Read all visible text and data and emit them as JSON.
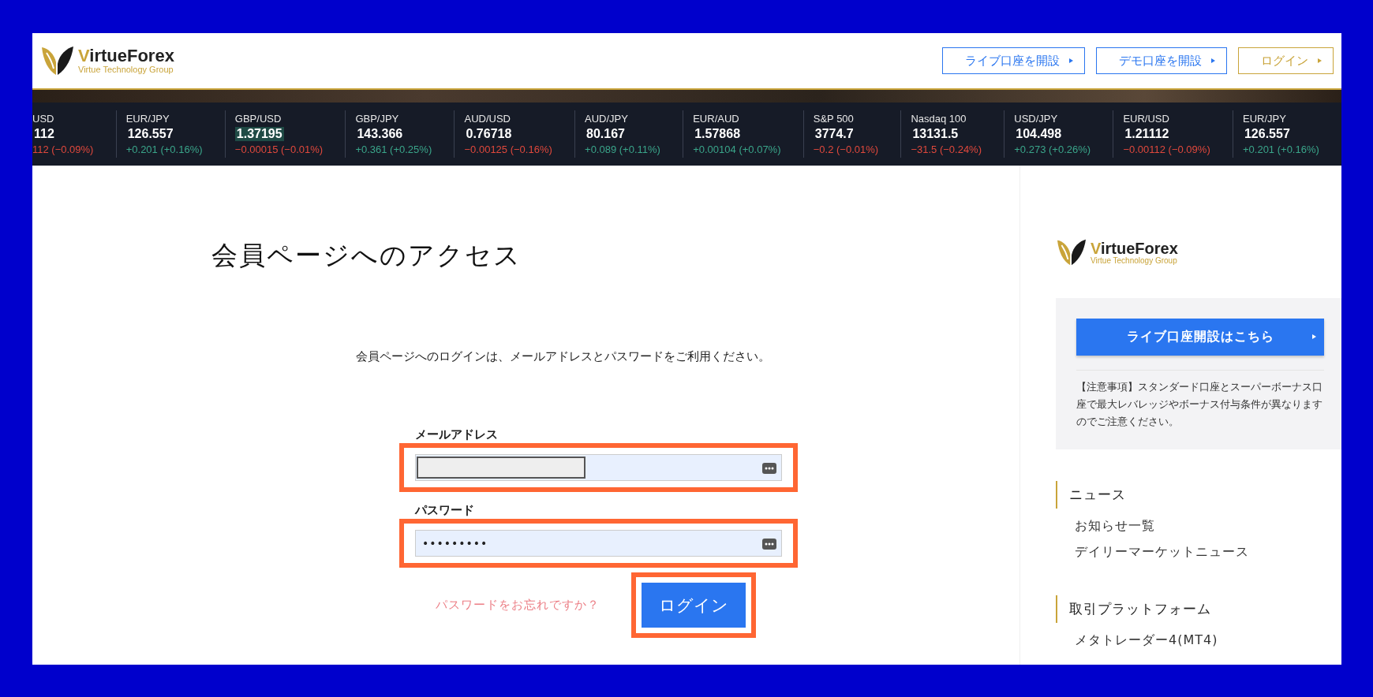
{
  "header": {
    "logo": {
      "name": "VirtueForex",
      "tagline": "Virtue Technology Group"
    },
    "buttons": [
      {
        "label": "ライブ口座を開設",
        "kind": "primary"
      },
      {
        "label": "デモ口座を開設",
        "kind": "primary"
      },
      {
        "label": "ログイン",
        "kind": "gold"
      }
    ]
  },
  "ticker": [
    {
      "symbol": "USD",
      "price": "112",
      "change": "112 (−0.09%)",
      "rising": false,
      "highlighted": false
    },
    {
      "symbol": "EUR/JPY",
      "price": "126.557",
      "change": "+0.201 (+0.16%)",
      "rising": true,
      "highlighted": false
    },
    {
      "symbol": "GBP/USD",
      "price": "1.37195",
      "change": "−0.00015 (−0.01%)",
      "rising": false,
      "highlighted": true
    },
    {
      "symbol": "GBP/JPY",
      "price": "143.366",
      "change": "+0.361 (+0.25%)",
      "rising": true,
      "highlighted": false
    },
    {
      "symbol": "AUD/USD",
      "price": "0.76718",
      "change": "−0.00125 (−0.16%)",
      "rising": false,
      "highlighted": false
    },
    {
      "symbol": "AUD/JPY",
      "price": "80.167",
      "change": "+0.089 (+0.11%)",
      "rising": true,
      "highlighted": false
    },
    {
      "symbol": "EUR/AUD",
      "price": "1.57868",
      "change": "+0.00104 (+0.07%)",
      "rising": true,
      "highlighted": false
    },
    {
      "symbol": "S&P 500",
      "price": "3774.7",
      "change": "−0.2 (−0.01%)",
      "rising": false,
      "highlighted": false
    },
    {
      "symbol": "Nasdaq 100",
      "price": "13131.5",
      "change": "−31.5 (−0.24%)",
      "rising": false,
      "highlighted": false
    },
    {
      "symbol": "USD/JPY",
      "price": "104.498",
      "change": "+0.273 (+0.26%)",
      "rising": true,
      "highlighted": false
    },
    {
      "symbol": "EUR/USD",
      "price": "1.21112",
      "change": "−0.00112 (−0.09%)",
      "rising": false,
      "highlighted": false
    },
    {
      "symbol": "EUR/JPY",
      "price": "126.557",
      "change": "+0.201 (+0.16%)",
      "rising": true,
      "highlighted": false
    }
  ],
  "login": {
    "title": "会員ページへのアクセス",
    "instruction": "会員ページへのログインは、メールアドレスとパスワードをご利用ください。",
    "fields": [
      {
        "label": "メールアドレス",
        "kind": "email",
        "highlighted": true
      },
      {
        "label": "パスワード",
        "kind": "password",
        "value": "•••••••••",
        "highlighted": true
      }
    ],
    "forgot_link": "パスワードをお忘れですか？",
    "submit": {
      "label": "ログイン",
      "highlighted": true
    }
  },
  "sidebar": {
    "logo": {
      "name": "VirtueForex",
      "tagline": "Virtue Technology Group"
    },
    "cta_button": "ライブ口座開設はこちら",
    "notice": "【注意事項】スタンダード口座とスーパーボーナス口座で最大レバレッジやボーナス付与条件が異なりますのでご注意ください。",
    "sections": [
      {
        "title": "ニュース",
        "items": [
          "お知らせ一覧",
          "デイリーマーケットニュース"
        ]
      },
      {
        "title": "取引プラットフォーム",
        "items": [
          "メタトレーダー4(MT4)"
        ]
      }
    ]
  }
}
